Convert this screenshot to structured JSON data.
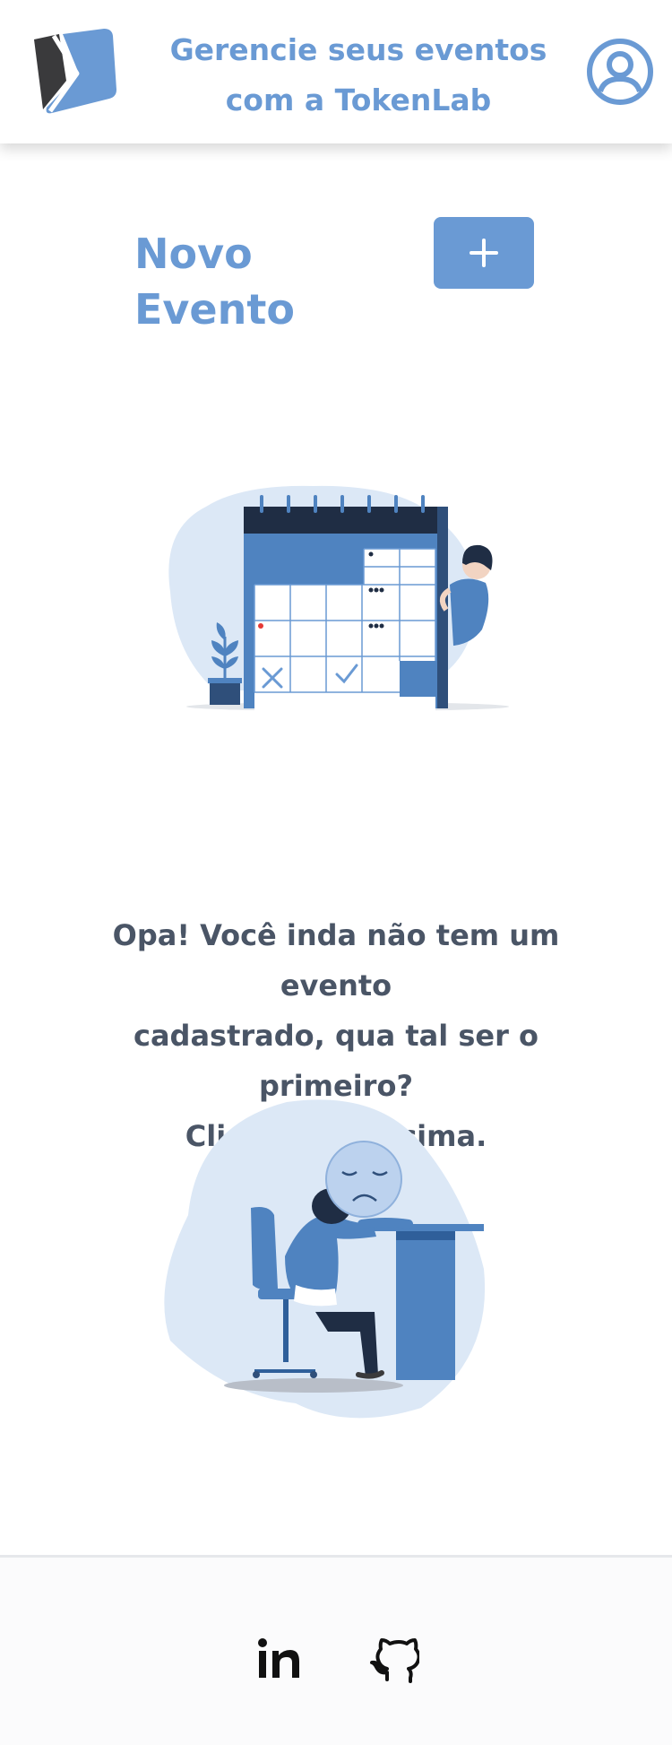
{
  "header": {
    "title_line1": "Gerencie seus eventos",
    "title_line2": "com a TokenLab",
    "logo_icon": "tokenlab-logo-icon",
    "profile_icon": "user-profile-icon"
  },
  "main": {
    "new_event_label": "Novo Evento",
    "add_button_icon": "plus-icon",
    "calendar_illustration": "calendar-illustration",
    "empty_message": {
      "line1": "Opa! Você inda não tem um evento",
      "line2": "cadastrado, qua tal ser o primeiro?",
      "line3": "Clique no + acima."
    },
    "sad_illustration": "sad-person-illustration"
  },
  "footer": {
    "links": [
      {
        "icon": "linkedin-icon"
      },
      {
        "icon": "github-icon"
      }
    ]
  },
  "colors": {
    "brand": "#6a9ad4",
    "text_dark": "#4a5566",
    "navy": "#1f2d44",
    "blob": "#dce8f6"
  }
}
